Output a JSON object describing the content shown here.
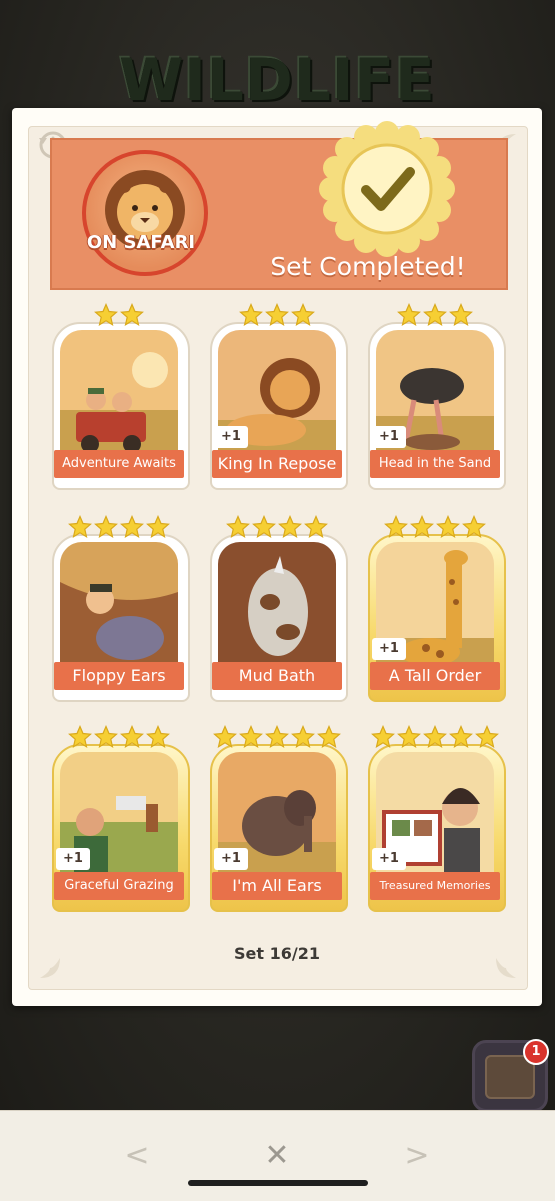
{
  "background_title": "WILDLIFE",
  "notification_badge": "1",
  "header": {
    "set_name": "ON SAFARI",
    "status": "Set Completed!",
    "seal_icon": "checkmark-seal-icon"
  },
  "stickers": [
    {
      "name": "Adventure Awaits",
      "stars": 2,
      "plus": "",
      "gold": false
    },
    {
      "name": "King In Repose",
      "stars": 3,
      "plus": "+1",
      "gold": false
    },
    {
      "name": "Head in the Sand",
      "stars": 3,
      "plus": "+1",
      "gold": false
    },
    {
      "name": "Floppy Ears",
      "stars": 4,
      "plus": "",
      "gold": false
    },
    {
      "name": "Mud Bath",
      "stars": 4,
      "plus": "",
      "gold": false
    },
    {
      "name": "A Tall Order",
      "stars": 4,
      "plus": "+1",
      "gold": true
    },
    {
      "name": "Graceful Grazing",
      "stars": 4,
      "plus": "+1",
      "gold": true
    },
    {
      "name": "I'm All Ears",
      "stars": 5,
      "plus": "+1",
      "gold": true
    },
    {
      "name": "Treasured Memories",
      "stars": 5,
      "plus": "+1",
      "gold": true
    }
  ],
  "set_count": "Set 16/21",
  "nav": {
    "prev": "<",
    "close": "✕",
    "next": ">"
  },
  "colors": {
    "header_bg": "#e98f65",
    "label_bg": "#e8714a",
    "star": "#f6cf33"
  }
}
